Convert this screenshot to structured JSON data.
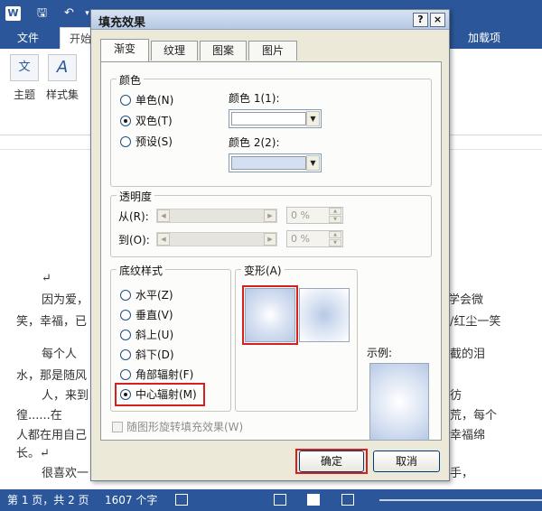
{
  "word": {
    "ribbon_tabs": {
      "file": "文件",
      "home": "开始",
      "addins": "加载项"
    },
    "ribbon_buttons": {
      "theme": "主题",
      "style_set": "样式集"
    },
    "theme_icon_text": "文",
    "style_icon_text": "A",
    "logo_text": "W",
    "doc_lines": [
      {
        "text": "↵"
      },
      {
        "text": "因为爱，",
        "right": "学会微"
      },
      {
        "text": "笑，幸福，已",
        "right": "/红尘一笑"
      },
      {
        "text": "每个人",
        "right": "截的泪"
      },
      {
        "text": "水，那是随风",
        "right": ""
      },
      {
        "text": "人，来到",
        "right": "彷"
      },
      {
        "text": "徨......在",
        "right": "荒，每个"
      },
      {
        "text": "人都在用自己",
        "right": "幸福绵"
      },
      {
        "text": "长。↵",
        "right": ""
      },
      {
        "text": "很喜欢一",
        "right": "手，"
      }
    ],
    "status": {
      "page": "第 1 页，共 2 页",
      "words": "1607 个字"
    }
  },
  "dialog": {
    "title": "填充效果",
    "help": "?",
    "close": "×",
    "tabs": [
      "渐变",
      "纹理",
      "图案",
      "图片"
    ],
    "active_tab": 0,
    "colors_group": {
      "legend": "颜色",
      "options": [
        "单色(N)",
        "双色(T)",
        "预设(S)"
      ],
      "selected": 1,
      "color1_label": "颜色 1(1):",
      "color1_value": "#ffffff",
      "color2_label": "颜色 2(2):",
      "color2_value": "#d3dff2"
    },
    "transparency": {
      "legend": "透明度",
      "from_label": "从(R):",
      "to_label": "到(O):",
      "from_value": "0 %",
      "to_value": "0 %"
    },
    "shading": {
      "legend": "底纹样式",
      "options": [
        "水平(Z)",
        "垂直(V)",
        "斜上(U)",
        "斜下(D)",
        "角部辐射(F)",
        "中心辐射(M)"
      ],
      "selected": 5
    },
    "variants_legend": "变形(A)",
    "sample_label": "示例:",
    "rotate_checkbox": "随图形旋转填充效果(W)",
    "ok": "确定",
    "cancel": "取消",
    "highlight_color": "#d62020",
    "gradient_colors": [
      "#ffffff",
      "#b8c9e6"
    ]
  }
}
